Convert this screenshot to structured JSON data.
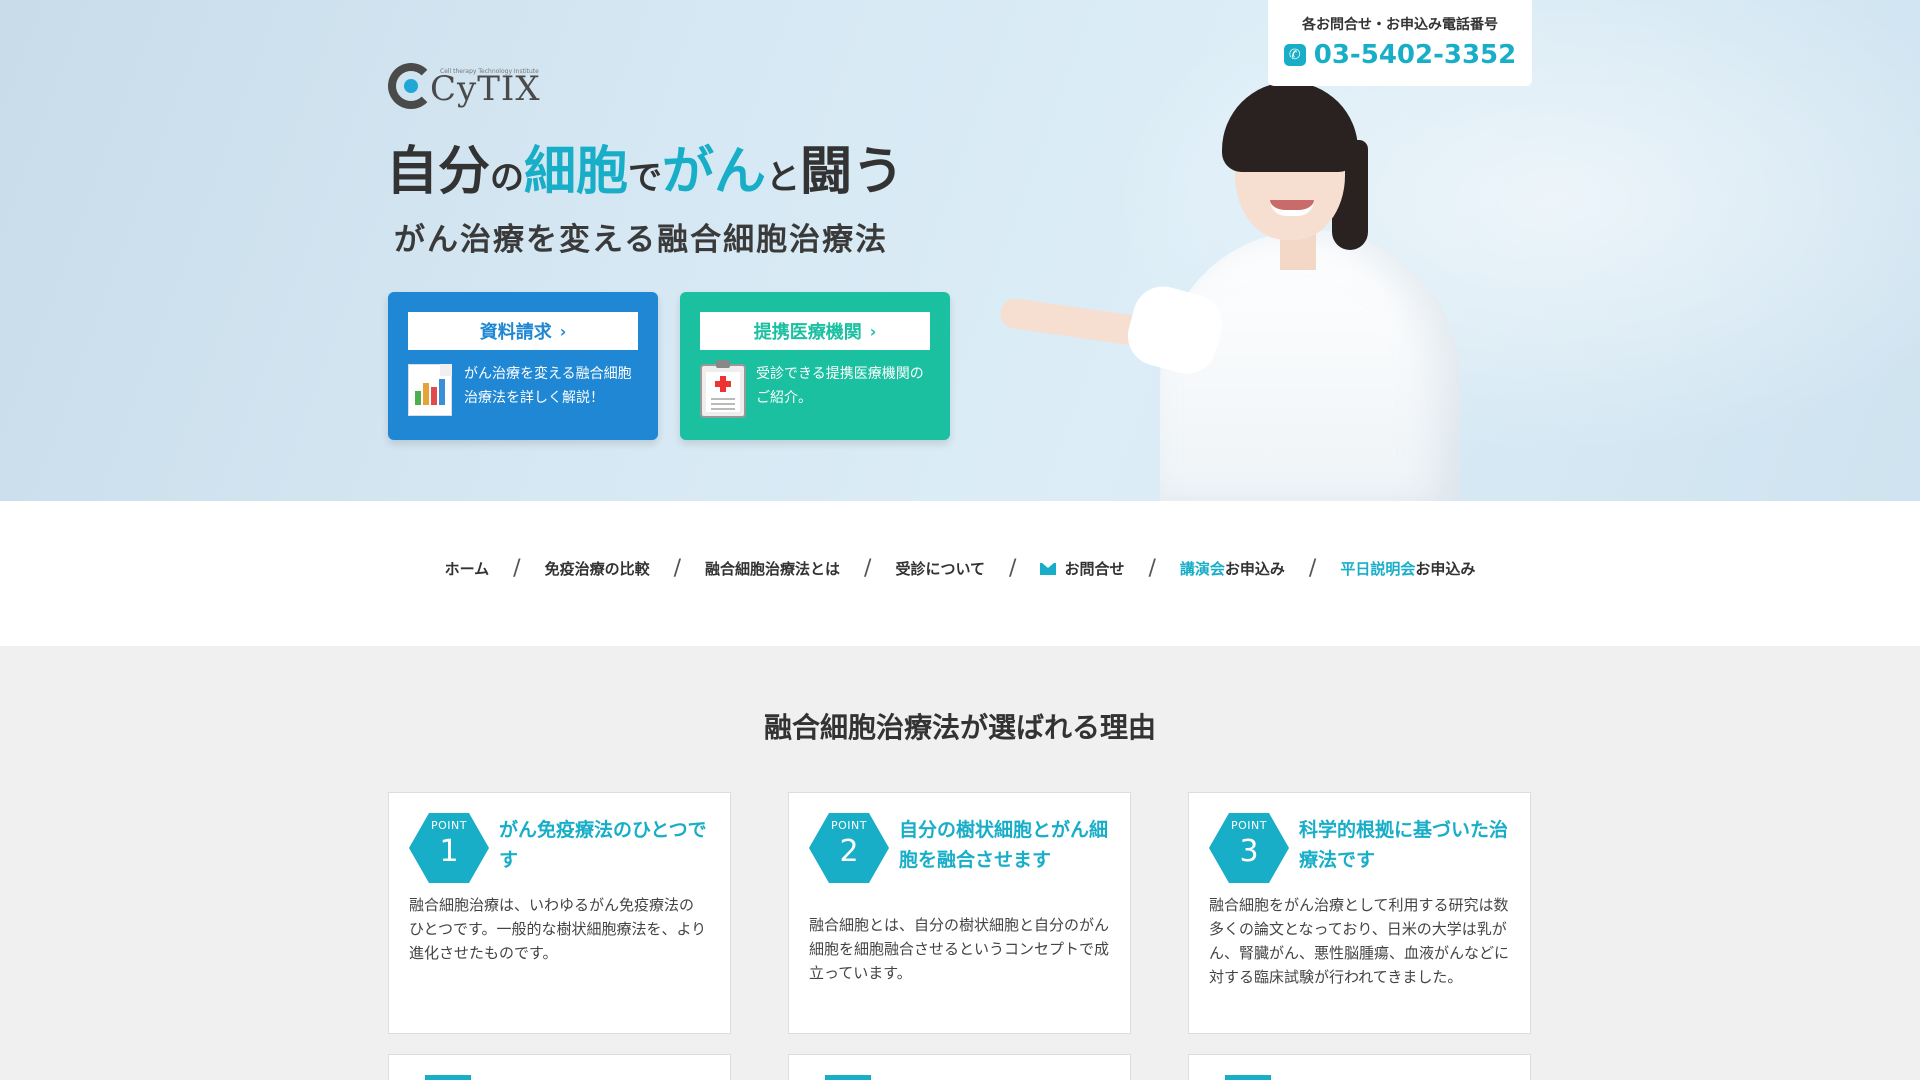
{
  "logo": {
    "text": "CyTIX",
    "tagline": "Cell therapy Technology Institute"
  },
  "hero": {
    "title_parts": [
      {
        "text": "自分",
        "style": "big"
      },
      {
        "text": "の",
        "style": "small"
      },
      {
        "text": "細胞",
        "style": "big accent"
      },
      {
        "text": "で",
        "style": "small"
      },
      {
        "text": "がん",
        "style": "big accent"
      },
      {
        "text": "と",
        "style": "small"
      },
      {
        "text": "闘う",
        "style": "big"
      }
    ],
    "subtitle": "がん治療を変える融合細胞治療法"
  },
  "cta": {
    "request": {
      "label": "資料請求",
      "text": "がん治療を変える融合細胞治療法を詳しく解説！"
    },
    "clinics": {
      "label": "提携医療機関",
      "text": "受診できる提携医療機関のご紹介。"
    }
  },
  "phone": {
    "label": "各お問合せ・お申込み電話番号",
    "number": "03-5402-3352"
  },
  "nav": {
    "home": "ホーム",
    "compare": "免疫治療の比較",
    "about": "融合細胞治療法とは",
    "visit": "受診について",
    "contact": "お問合せ",
    "lecture_hl": "講演会",
    "lecture_rest": "お申込み",
    "weekday_hl": "平日説明会",
    "weekday_rest": "お申込み"
  },
  "section": {
    "title": "融合細胞治療法が選ばれる理由"
  },
  "points_label": "POINT",
  "cards": [
    {
      "num": "1",
      "title": "がん免疫療法のひとつです",
      "body": "融合細胞治療は、いわゆるがん免疫療法のひとつです。一般的な樹状細胞療法を、より進化させたものです。"
    },
    {
      "num": "2",
      "title": "自分の樹状細胞とがん細胞を融合させます",
      "body": "融合細胞とは、自分の樹状細胞と自分のがん細胞を細胞融合させるというコンセプトで成立っています。"
    },
    {
      "num": "3",
      "title": "科学的根拠に基づいた治療法です",
      "body": "融合細胞をがん治療として利用する研究は数多くの論文となっており、日米の大学は乳がん、腎臓がん、悪性脳腫瘍、血液がんなどに対する臨床試験が行われてきました。"
    }
  ],
  "colors": {
    "accent": "#18aec8",
    "blue": "#1f87d3",
    "green": "#1bc0a1"
  }
}
